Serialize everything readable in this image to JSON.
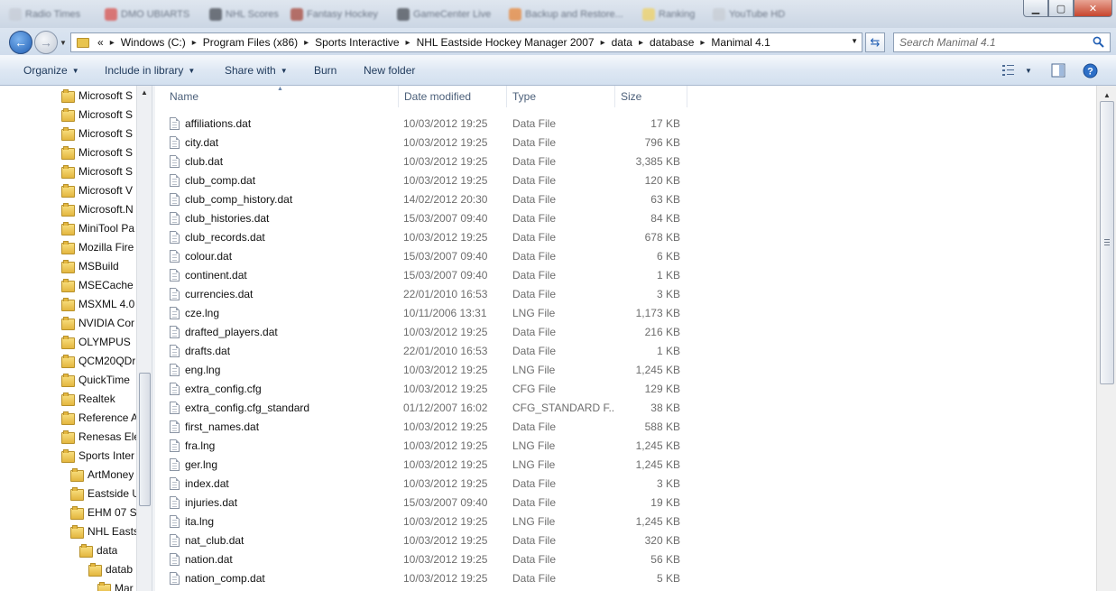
{
  "titlebar": {
    "bookmarks": [
      "Radio Times",
      "DMO UBIARTS",
      "NHL Scores",
      "Fantasy Hockey",
      "GameCenter Live",
      "Backup and Restore...",
      "Ranking",
      "YouTube HD"
    ],
    "bookmark_colors": [
      "#c6ccd6",
      "#d9534f",
      "#4a4f57",
      "#a84a3d",
      "#4a4f57",
      "#e8873a",
      "#f0d264",
      "#c8cdd4"
    ]
  },
  "address": {
    "overflow": "«",
    "segments": [
      "Windows (C:)",
      "Program Files (x86)",
      "Sports Interactive",
      "NHL Eastside Hockey Manager 2007",
      "data",
      "database",
      "Manimal 4.1"
    ]
  },
  "search": {
    "placeholder": "Search Manimal 4.1"
  },
  "toolbar": {
    "organize": "Organize",
    "include": "Include in library",
    "share": "Share with",
    "burn": "Burn",
    "new_folder": "New folder"
  },
  "nav": {
    "items": [
      "Microsoft S",
      "Microsoft S",
      "Microsoft S",
      "Microsoft S",
      "Microsoft S",
      "Microsoft V",
      "Microsoft.N",
      "MiniTool Pa",
      "Mozilla Fire",
      "MSBuild",
      "MSECache",
      "MSXML 4.0",
      "NVIDIA Cor",
      "OLYMPUS",
      "QCM20QDr",
      "QuickTime",
      "Realtek",
      "Reference A",
      "Renesas Ele",
      "Sports Inter",
      "ArtMoney",
      "Eastside U",
      "EHM 07 S",
      "NHL Easts",
      "data",
      "datab",
      "Mar"
    ]
  },
  "columns": {
    "name": "Name",
    "date": "Date modified",
    "type": "Type",
    "size": "Size"
  },
  "files": [
    {
      "name": "affiliations.dat",
      "date": "10/03/2012 19:25",
      "type": "Data File",
      "size": "17 KB"
    },
    {
      "name": "city.dat",
      "date": "10/03/2012 19:25",
      "type": "Data File",
      "size": "796 KB"
    },
    {
      "name": "club.dat",
      "date": "10/03/2012 19:25",
      "type": "Data File",
      "size": "3,385 KB"
    },
    {
      "name": "club_comp.dat",
      "date": "10/03/2012 19:25",
      "type": "Data File",
      "size": "120 KB"
    },
    {
      "name": "club_comp_history.dat",
      "date": "14/02/2012 20:30",
      "type": "Data File",
      "size": "63 KB"
    },
    {
      "name": "club_histories.dat",
      "date": "15/03/2007 09:40",
      "type": "Data File",
      "size": "84 KB"
    },
    {
      "name": "club_records.dat",
      "date": "10/03/2012 19:25",
      "type": "Data File",
      "size": "678 KB"
    },
    {
      "name": "colour.dat",
      "date": "15/03/2007 09:40",
      "type": "Data File",
      "size": "6 KB"
    },
    {
      "name": "continent.dat",
      "date": "15/03/2007 09:40",
      "type": "Data File",
      "size": "1 KB"
    },
    {
      "name": "currencies.dat",
      "date": "22/01/2010 16:53",
      "type": "Data File",
      "size": "3 KB"
    },
    {
      "name": "cze.lng",
      "date": "10/11/2006 13:31",
      "type": "LNG File",
      "size": "1,173 KB"
    },
    {
      "name": "drafted_players.dat",
      "date": "10/03/2012 19:25",
      "type": "Data File",
      "size": "216 KB"
    },
    {
      "name": "drafts.dat",
      "date": "22/01/2010 16:53",
      "type": "Data File",
      "size": "1 KB"
    },
    {
      "name": "eng.lng",
      "date": "10/03/2012 19:25",
      "type": "LNG File",
      "size": "1,245 KB"
    },
    {
      "name": "extra_config.cfg",
      "date": "10/03/2012 19:25",
      "type": "CFG File",
      "size": "129 KB"
    },
    {
      "name": "extra_config.cfg_standard",
      "date": "01/12/2007 16:02",
      "type": "CFG_STANDARD F...",
      "size": "38 KB"
    },
    {
      "name": "first_names.dat",
      "date": "10/03/2012 19:25",
      "type": "Data File",
      "size": "588 KB"
    },
    {
      "name": "fra.lng",
      "date": "10/03/2012 19:25",
      "type": "LNG File",
      "size": "1,245 KB"
    },
    {
      "name": "ger.lng",
      "date": "10/03/2012 19:25",
      "type": "LNG File",
      "size": "1,245 KB"
    },
    {
      "name": "index.dat",
      "date": "10/03/2012 19:25",
      "type": "Data File",
      "size": "3 KB"
    },
    {
      "name": "injuries.dat",
      "date": "15/03/2007 09:40",
      "type": "Data File",
      "size": "19 KB"
    },
    {
      "name": "ita.lng",
      "date": "10/03/2012 19:25",
      "type": "LNG File",
      "size": "1,245 KB"
    },
    {
      "name": "nat_club.dat",
      "date": "10/03/2012 19:25",
      "type": "Data File",
      "size": "320 KB"
    },
    {
      "name": "nation.dat",
      "date": "10/03/2012 19:25",
      "type": "Data File",
      "size": "56 KB"
    },
    {
      "name": "nation_comp.dat",
      "date": "10/03/2012 19:25",
      "type": "Data File",
      "size": "5 KB"
    }
  ]
}
